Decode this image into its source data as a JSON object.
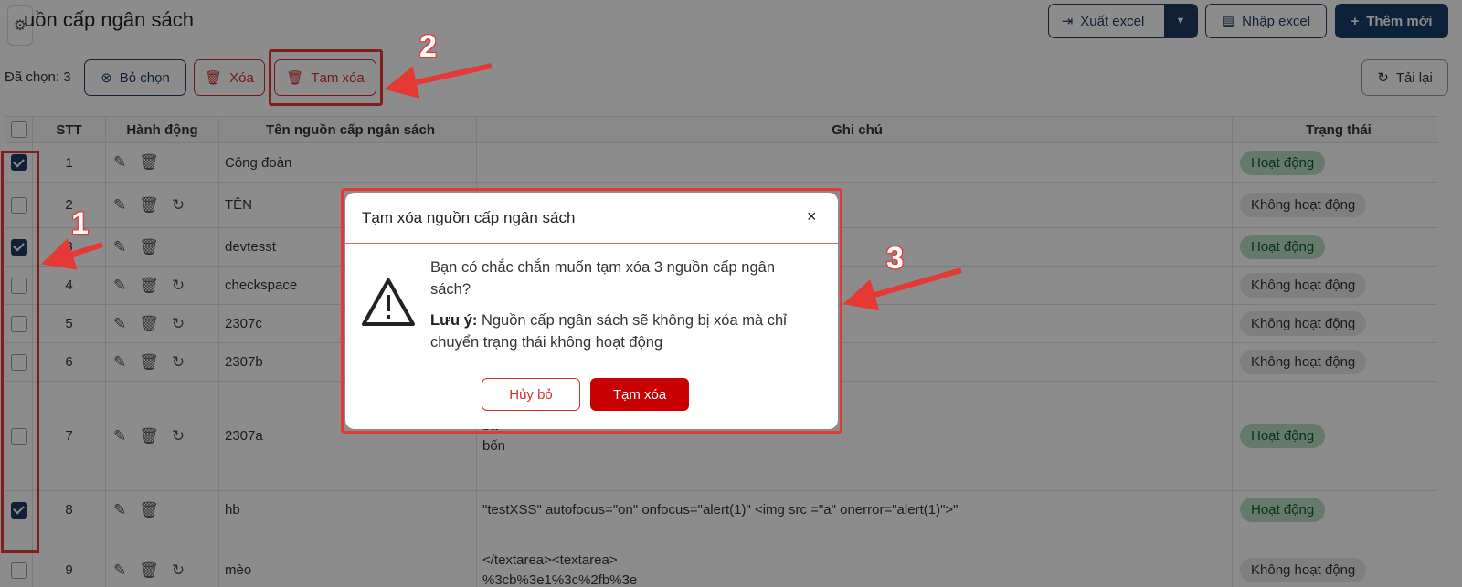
{
  "header": {
    "title": "uồn cấp ngân sách",
    "export_label": "Xuất excel",
    "import_label": "Nhập excel",
    "add_label": "Thêm mới"
  },
  "toolbar": {
    "selected_count": "Đã chọn: 3",
    "unselect_label": "Bỏ chọn",
    "delete_label": "Xóa",
    "temp_delete_label": "Tạm xóa",
    "reload_label": "Tải lại"
  },
  "table": {
    "columns": [
      "STT",
      "Hành động",
      "Tên nguồn cấp ngân sách",
      "Ghi chú",
      "Trạng thái"
    ],
    "rows": [
      {
        "stt": "1",
        "name": "Công đoàn",
        "note": "",
        "status": "Hoạt động",
        "checked": true
      },
      {
        "stt": "2",
        "name": "TÊN",
        "note": "",
        "status": "Không hoạt động",
        "checked": false
      },
      {
        "stt": "3",
        "name": "devtesst",
        "note": "",
        "status": "Hoạt động",
        "checked": true
      },
      {
        "stt": "4",
        "name": "checkspace",
        "note": "",
        "status": "Không hoạt động",
        "checked": false
      },
      {
        "stt": "5",
        "name": "2307c",
        "note": "",
        "status": "Không hoạt động",
        "checked": false
      },
      {
        "stt": "6",
        "name": "2307b",
        "note": "",
        "status": "Không hoạt động",
        "checked": false
      },
      {
        "stt": "7",
        "name": "2307a",
        "note_lines": [
          "ba",
          "bốn"
        ],
        "status": "Hoạt động",
        "checked": false
      },
      {
        "stt": "8",
        "name": "hb",
        "note": "\"testXSS\" autofocus=\"on\" onfocus=\"alert(1)\" <img src =\"a\" onerror=\"alert(1)\">\"",
        "status": "Hoạt động",
        "checked": true
      },
      {
        "stt": "9",
        "name": "mèo",
        "note_lines": [
          "</textarea><textarea>",
          "%3cb%3e1%3c%2fb%3e"
        ],
        "status": "Không hoạt động",
        "checked": false
      }
    ]
  },
  "dialog": {
    "title": "Tạm xóa nguồn cấp ngân sách",
    "close": "×",
    "message": "Bạn có chắc chắn muốn tạm xóa 3 nguồn cấp ngân sách?",
    "note_label": "Lưu ý:",
    "note_text": " Nguồn cấp ngân sách sẽ không bị xóa mà chỉ chuyển trạng thái không hoạt động",
    "cancel_label": "Hủy bỏ",
    "confirm_label": "Tạm xóa"
  },
  "annotations": [
    "1",
    "2",
    "3"
  ],
  "colors": {
    "primary": "#1f3b5f",
    "danger": "#c80000",
    "highlight": "#e53935",
    "active_badge": "#b9dfc1",
    "inactive_badge": "#e8e8e8"
  }
}
